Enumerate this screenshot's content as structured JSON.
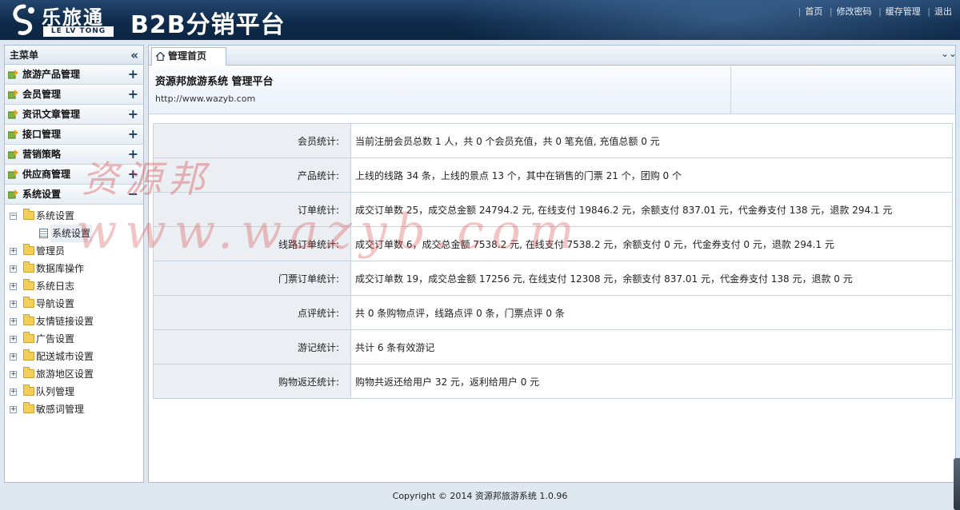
{
  "header": {
    "logo_cn": "乐旅通",
    "logo_en": "LE LV TONG",
    "platform_title": "B2B分销平台",
    "nav": [
      {
        "label": "首页"
      },
      {
        "label": "修改密码"
      },
      {
        "label": "缓存管理"
      },
      {
        "label": "退出"
      }
    ]
  },
  "sidebar": {
    "title": "主菜单",
    "collapse_icon": "double-chevron-left-icon",
    "menus": [
      {
        "label": "旅游产品管理",
        "toggle": "+"
      },
      {
        "label": "会员管理",
        "toggle": "+"
      },
      {
        "label": "资讯文章管理",
        "toggle": "+"
      },
      {
        "label": "接口管理",
        "toggle": "+"
      },
      {
        "label": "营销策略",
        "toggle": "+"
      },
      {
        "label": "供应商管理",
        "toggle": "+"
      },
      {
        "label": "系统设置",
        "toggle": "−"
      }
    ],
    "tree": [
      {
        "label": "系统设置",
        "expander": "−"
      },
      {
        "label": "系统设置",
        "child": true
      },
      {
        "label": "管理员",
        "expander": "+"
      },
      {
        "label": "数据库操作",
        "expander": "+"
      },
      {
        "label": "系统日志",
        "expander": "+"
      },
      {
        "label": "导航设置",
        "expander": "+"
      },
      {
        "label": "友情链接设置",
        "expander": "+"
      },
      {
        "label": "广告设置",
        "expander": "+"
      },
      {
        "label": "配送城市设置",
        "expander": "+"
      },
      {
        "label": "旅游地区设置",
        "expander": "+"
      },
      {
        "label": "队列管理",
        "expander": "+"
      },
      {
        "label": "敏感词管理",
        "expander": "+"
      }
    ]
  },
  "main": {
    "tab_label": "管理首页",
    "site_title": "资源邦旅游系统 管理平台",
    "site_url": "http://www.wazyb.com",
    "stats": [
      {
        "key": "会员统计:",
        "value": "当前注册会员总数 1 人，共 0 个会员充值，共 0 笔充值, 充值总额 0 元"
      },
      {
        "key": "产品统计:",
        "value": "上线的线路 34 条，上线的景点 13 个，其中在销售的门票 21 个，团购 0 个"
      },
      {
        "key": "订单统计:",
        "value": "成交订单数 25，成交总金额 24794.2 元, 在线支付 19846.2 元，余额支付 837.01 元，代金券支付 138 元，退款 294.1 元"
      },
      {
        "key": "线路订单统计:",
        "value": "成交订单数 6，成交总金额 7538.2 元, 在线支付 7538.2 元，余额支付 0 元，代金券支付 0 元，退款 294.1 元"
      },
      {
        "key": "门票订单统计:",
        "value": "成交订单数 19，成交总金额 17256 元, 在线支付 12308 元，余额支付 837.01 元，代金券支付 138 元，退款 0 元"
      },
      {
        "key": "点评统计:",
        "value": "共 0 条购物点评，线路点评 0 条，门票点评 0 条"
      },
      {
        "key": "游记统计:",
        "value": "共计 6 条有效游记"
      },
      {
        "key": "购物返还统计:",
        "value": "购物共返还给用户 32 元，返利给用户 0 元"
      }
    ]
  },
  "watermark": {
    "cn": "资源邦",
    "en": "www.wazyb.com"
  },
  "footer": "Copyright © 2014 资源邦旅游系统 1.0.96"
}
